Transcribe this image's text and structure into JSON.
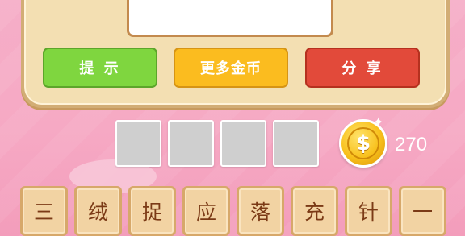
{
  "buttons": {
    "hint": "提 示",
    "more_coins": "更多金币",
    "share": "分 享"
  },
  "answer_slots": [
    "",
    "",
    "",
    ""
  ],
  "coins": {
    "icon": "dollar-coin-icon",
    "symbol": "$",
    "count": "270"
  },
  "letters": [
    "三",
    "绒",
    "捉",
    "应",
    "落",
    "充",
    "针",
    "一"
  ],
  "colors": {
    "background": "#f6a9c4",
    "hint_button": "#7fd63f",
    "coins_button": "#fbbc1f",
    "share_button": "#e24a3a",
    "tile": "#f2d3a3",
    "tile_text": "#7b3a16"
  }
}
